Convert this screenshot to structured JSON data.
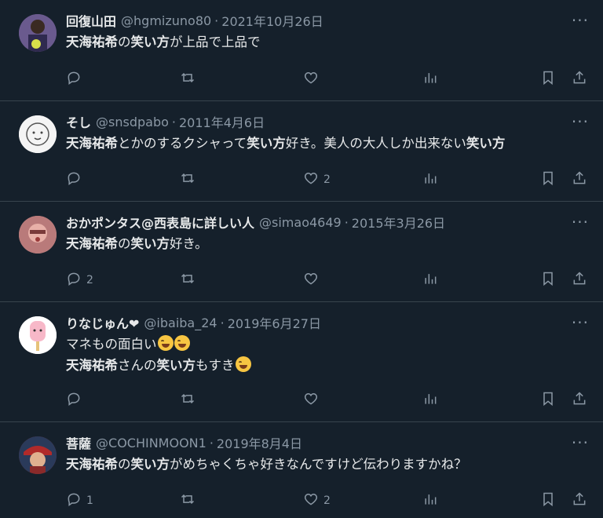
{
  "tweets": [
    {
      "name": "回復山田",
      "handle": "@hgmizuno80",
      "date": "2021年10月26日",
      "lines": [
        [
          {
            "t": "天海祐希",
            "b": true
          },
          {
            "t": "の",
            "b": false
          },
          {
            "t": "笑い方",
            "b": true
          },
          {
            "t": "が上品で上品で",
            "b": false
          }
        ]
      ],
      "replies": "",
      "likes": ""
    },
    {
      "name": "そし",
      "handle": "@snsdpabo",
      "date": "2011年4月6日",
      "lines": [
        [
          {
            "t": "天海祐希",
            "b": true
          },
          {
            "t": "とかのするクシャって",
            "b": false
          },
          {
            "t": "笑い方",
            "b": true
          },
          {
            "t": "好き。美人の大人しか出来ない",
            "b": false
          },
          {
            "t": "笑い方",
            "b": true
          }
        ]
      ],
      "replies": "",
      "likes": "2"
    },
    {
      "name": "おかポンタス@西表島に詳しい人",
      "handle": "@simao4649",
      "date": "2015年3月26日",
      "lines": [
        [
          {
            "t": "天海祐希",
            "b": true
          },
          {
            "t": "の",
            "b": false
          },
          {
            "t": "笑い方",
            "b": true
          },
          {
            "t": "好き。",
            "b": false
          }
        ]
      ],
      "replies": "2",
      "likes": ""
    },
    {
      "name": "りなじゅん❤",
      "handle": "@ibaiba_24",
      "date": "2019年6月27日",
      "lines": [
        [
          {
            "t": "マネもの面白い",
            "b": false
          },
          {
            "emoji": "face-with-tears-of-joy"
          },
          {
            "emoji": "face-with-tears-of-joy"
          }
        ],
        [
          {
            "t": "天海祐希",
            "b": true
          },
          {
            "t": "さんの",
            "b": false
          },
          {
            "t": "笑い方",
            "b": true
          },
          {
            "t": "もすき",
            "b": false
          },
          {
            "emoji": "face-with-tears-of-joy"
          }
        ]
      ],
      "replies": "",
      "likes": ""
    },
    {
      "name": "菩薩",
      "handle": "@COCHINMOON1",
      "date": "2019年8月4日",
      "lines": [
        [
          {
            "t": "天海祐希",
            "b": true
          },
          {
            "t": "の",
            "b": false
          },
          {
            "t": "笑い方",
            "b": true
          },
          {
            "t": "がめちゃくちゃ好きなんですけど伝わりますかね？",
            "b": false
          }
        ]
      ],
      "replies": "1",
      "likes": "2"
    }
  ],
  "separator": "·",
  "more_label": "···",
  "icons": [
    "reply-icon",
    "retweet-icon",
    "like-icon",
    "views-icon",
    "bookmark-icon",
    "share-icon"
  ],
  "colors": {
    "background": "#15202b",
    "text": "#e7e9ea",
    "muted": "#8b98a5",
    "divider": "#38444d"
  }
}
